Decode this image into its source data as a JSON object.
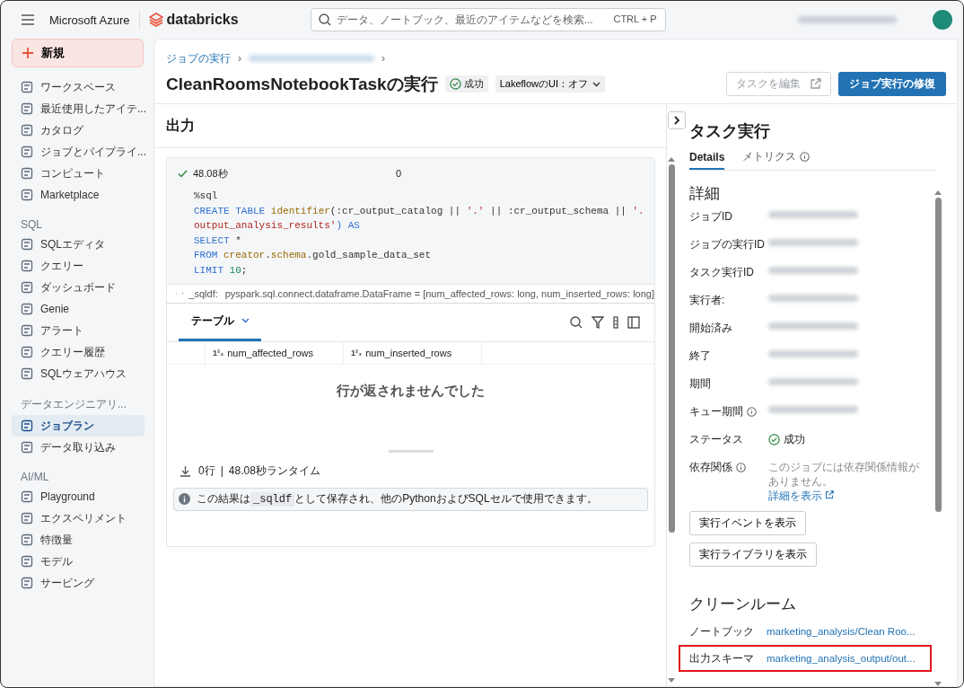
{
  "topbar": {
    "brand": "Microsoft Azure",
    "product": "databricks",
    "search": {
      "placeholder": "データ、ノートブック、最近のアイテムなどを検索...",
      "shortcut": "CTRL + P"
    }
  },
  "sidebar": {
    "new_button": "新規",
    "sections": [
      {
        "items": [
          {
            "label": "ワークスペース",
            "selected": false
          },
          {
            "label": "最近使用したアイテ...",
            "selected": false
          },
          {
            "label": "カタログ",
            "selected": false
          },
          {
            "label": "ジョブとパイプライ...",
            "selected": false
          },
          {
            "label": "コンピュート",
            "selected": false
          },
          {
            "label": "Marketplace",
            "selected": false
          }
        ]
      },
      {
        "heading": "SQL",
        "items": [
          {
            "label": "SQLエディタ",
            "selected": false
          },
          {
            "label": "クエリー",
            "selected": false
          },
          {
            "label": "ダッシュボード",
            "selected": false
          },
          {
            "label": "Genie",
            "selected": false
          },
          {
            "label": "アラート",
            "selected": false
          },
          {
            "label": "クエリー履歴",
            "selected": false
          },
          {
            "label": "SQLウェアハウス",
            "selected": false
          }
        ]
      },
      {
        "heading": "データエンジニアリ...",
        "items": [
          {
            "label": "ジョブラン",
            "selected": true
          },
          {
            "label": "データ取り込み",
            "selected": false
          }
        ]
      },
      {
        "heading": "AI/ML",
        "items": [
          {
            "label": "Playground",
            "selected": false
          },
          {
            "label": "エクスペリメント",
            "selected": false
          },
          {
            "label": "特徴量",
            "selected": false
          },
          {
            "label": "モデル",
            "selected": false
          },
          {
            "label": "サービング",
            "selected": false
          }
        ]
      }
    ]
  },
  "header": {
    "breadcrumb": "ジョブの実行",
    "separators": [
      "›",
      "›"
    ],
    "title": "CleanRoomsNotebookTaskの実行",
    "status": "成功",
    "lakeflow": "LakeflowのUI：オフ",
    "edit_button": {
      "label": "タスクを編集",
      "disabled": true
    },
    "repair_button": "ジョブ実行の修復"
  },
  "output": {
    "title": "出力",
    "cell": {
      "duration": "48.08秒",
      "count": "0",
      "code": [
        [
          {
            "kind": "plain",
            "text": "%sql"
          }
        ],
        [
          {
            "kind": "keyword",
            "text": "CREATE TABLE "
          },
          {
            "kind": "func",
            "text": "identifier"
          },
          {
            "kind": "plain",
            "text": "(:cr_output_catalog || "
          },
          {
            "kind": "string",
            "text": "'.'"
          },
          {
            "kind": "plain",
            "text": " || :cr_output_schema || "
          },
          {
            "kind": "string",
            "text": "'."
          }
        ],
        [
          {
            "kind": "string",
            "text": "output_analysis_results'"
          },
          {
            "kind": "keyword",
            "text": ") AS"
          }
        ],
        [
          {
            "kind": "keyword",
            "text": "SELECT"
          },
          {
            "kind": "plain",
            "text": " *"
          }
        ],
        [
          {
            "kind": "keyword",
            "text": "FROM "
          },
          {
            "kind": "func",
            "text": "creator"
          },
          {
            "kind": "plain",
            "text": "."
          },
          {
            "kind": "func",
            "text": "schema"
          },
          {
            "kind": "plain",
            "text": ".gold_sample_data_set"
          }
        ],
        [
          {
            "kind": "keyword",
            "text": "LIMIT "
          },
          {
            "kind": "number",
            "text": "10"
          },
          {
            "kind": "plain",
            "text": ";"
          }
        ]
      ],
      "schema_name": "_sqldf:",
      "schema": "pyspark.sql.connect.dataframe.DataFrame = [num_affected_rows: long, num_inserted_rows: long]",
      "result_tab": "テーブル",
      "columns": [
        {
          "type": "1²₃",
          "name": "num_affected_rows"
        },
        {
          "type": "1²₃",
          "name": "num_inserted_rows"
        }
      ],
      "empty_message": "行が返されませんでした",
      "rows": "0行",
      "divider": "|",
      "runtime": "48.08秒ランタイム",
      "info_parts": [
        "この結果は",
        "_sqldf",
        "として保存され、他のPythonおよびSQLセルで使用できます。"
      ]
    }
  },
  "task_panel": {
    "title": "タスク実行",
    "tabs": [
      {
        "label": "Details",
        "selected": true,
        "info": false
      },
      {
        "label": "メトリクス",
        "selected": false,
        "info": true
      }
    ],
    "details_title": "詳細",
    "rows": [
      {
        "kind": "redacted",
        "label": "ジョブID",
        "info": false
      },
      {
        "kind": "redacted",
        "label": "ジョブの実行ID",
        "info": false
      },
      {
        "kind": "redacted",
        "label": "タスク実行ID",
        "info": false
      },
      {
        "kind": "redacted",
        "label": "実行者:",
        "info": false
      },
      {
        "kind": "redacted",
        "label": "開始済み",
        "info": false
      },
      {
        "kind": "redacted",
        "label": "終了",
        "info": false
      },
      {
        "kind": "redacted",
        "label": "期間",
        "info": false
      },
      {
        "kind": "redacted",
        "label": "キュー期間",
        "info": true
      },
      {
        "kind": "status",
        "label": "ステータス",
        "info": false,
        "value": "成功"
      },
      {
        "kind": "dependency",
        "label": "依存関係",
        "info": true,
        "note": "このジョブには依存関係情報がありません。",
        "link": "詳細を表示"
      }
    ],
    "buttons": [
      "実行イベントを表示",
      "実行ライブラリを表示"
    ],
    "clean_room_title": "クリーンルーム",
    "clean_room": [
      {
        "label": "ノートブック",
        "value": "marketing_analysis/Clean Roo...",
        "highlighted": false
      },
      {
        "label": "出力スキーマ",
        "value": "marketing_analysis_output/out...",
        "highlighted": true
      }
    ]
  }
}
